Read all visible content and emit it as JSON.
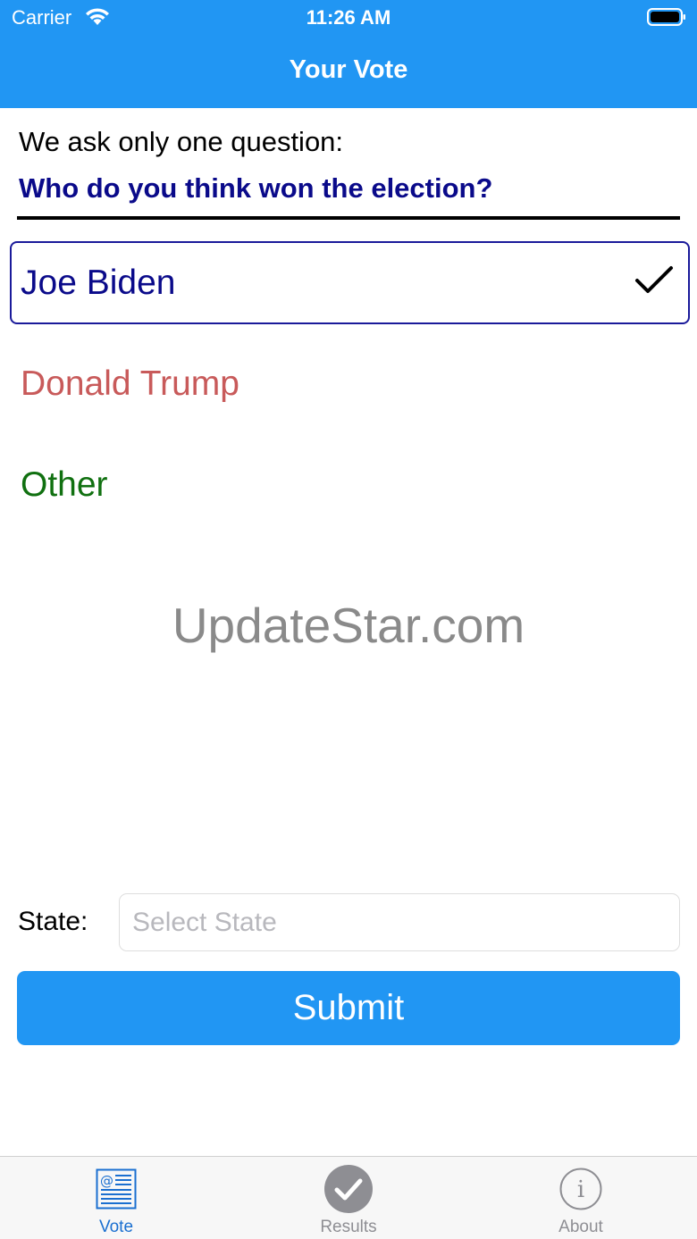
{
  "status_bar": {
    "carrier": "Carrier",
    "time": "11:26 AM"
  },
  "nav": {
    "title": "Your Vote"
  },
  "form": {
    "intro": "We ask only one question:",
    "question": "Who do you think won the election?",
    "options": [
      {
        "label": "Joe Biden",
        "selected": true,
        "color": "#0a0a8a"
      },
      {
        "label": "Donald Trump",
        "selected": false,
        "color": "#c85a5a"
      },
      {
        "label": "Other",
        "selected": false,
        "color": "#107010"
      }
    ],
    "state_label": "State:",
    "state_placeholder": "Select State",
    "submit_label": "Submit"
  },
  "watermark": "UpdateStar.com",
  "tabs": [
    {
      "label": "Vote",
      "icon": "newspaper-icon",
      "active": true
    },
    {
      "label": "Results",
      "icon": "checkmark-circle-icon",
      "active": false
    },
    {
      "label": "About",
      "icon": "info-icon",
      "active": false
    }
  ],
  "colors": {
    "accent": "#2196F3",
    "question": "#0a0a8a",
    "active_tab": "#1a6fd0",
    "inactive_tab": "#8e8e93"
  }
}
